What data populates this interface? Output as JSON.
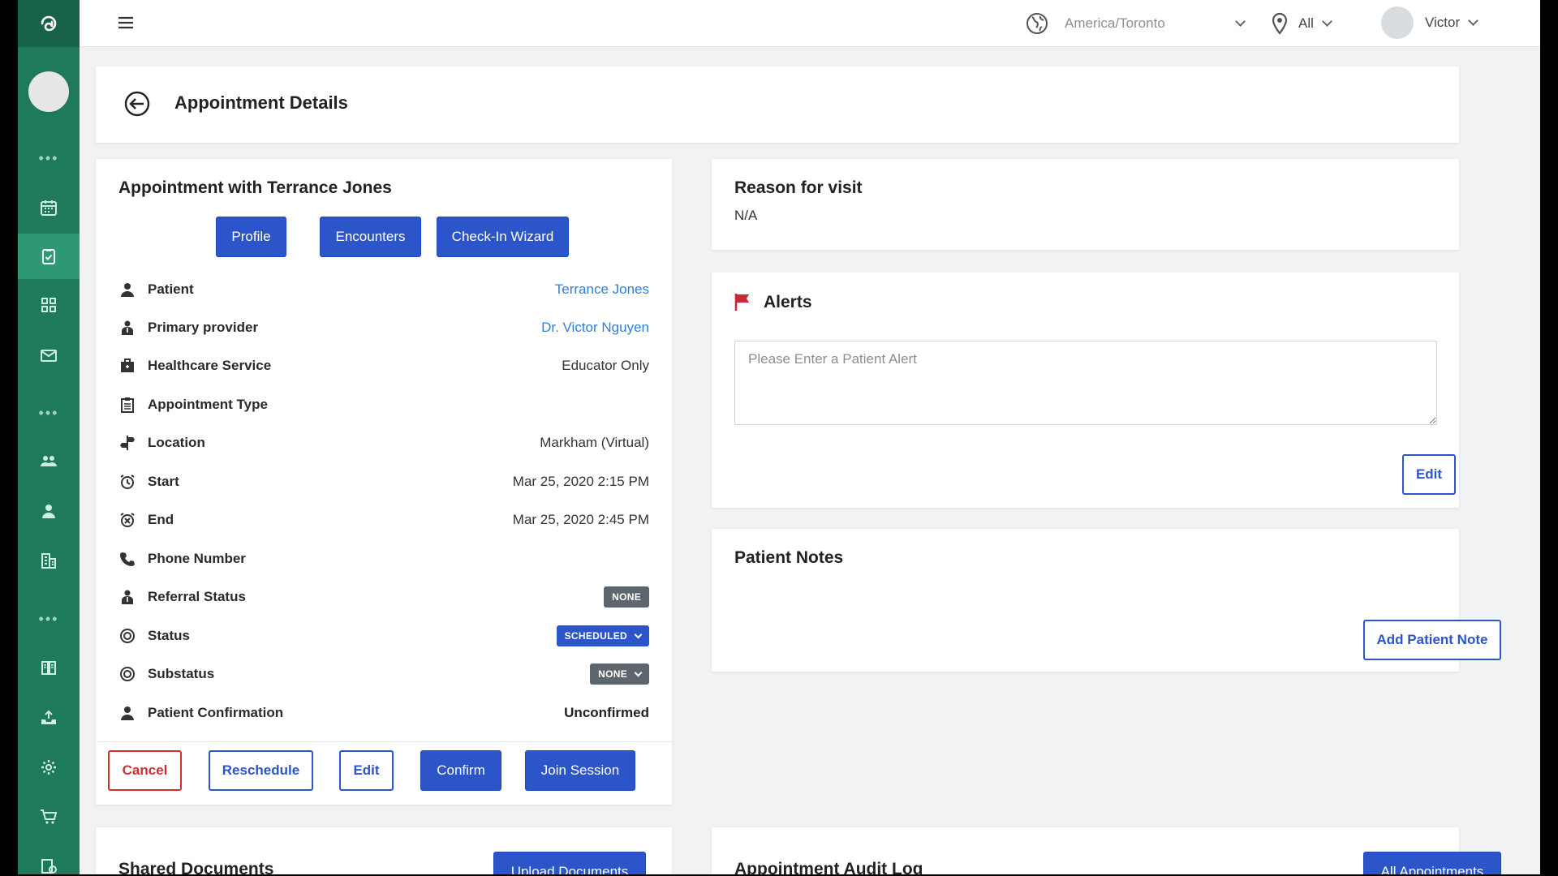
{
  "topbar": {
    "timezone": "America/Toronto",
    "location_filter": "All",
    "user_name": "Victor"
  },
  "header": {
    "title": "Appointment Details"
  },
  "appointment": {
    "title": "Appointment with Terrance Jones",
    "actions_top": {
      "profile": "Profile",
      "encounters": "Encounters",
      "checkin": "Check-In Wizard"
    },
    "rows": [
      {
        "label": "Patient",
        "value": "Terrance Jones",
        "icon": "user-icon"
      },
      {
        "label": "Primary provider",
        "value": "Dr. Victor Nguyen",
        "icon": "provider-icon"
      },
      {
        "label": "Healthcare Service",
        "value": "Educator Only",
        "icon": "briefcase-icon"
      },
      {
        "label": "Appointment Type",
        "value": "",
        "icon": "clipboard-icon"
      },
      {
        "label": "Location",
        "value": "Markham (Virtual)",
        "icon": "location-sign-icon"
      },
      {
        "label": "Start",
        "value": "Mar 25, 2020 2:15 PM",
        "icon": "alarm-icon"
      },
      {
        "label": "End",
        "value": "Mar 25, 2020 2:45 PM",
        "icon": "alarm-off-icon"
      },
      {
        "label": "Phone Number",
        "value": "",
        "icon": "phone-icon"
      },
      {
        "label": "Referral Status",
        "value": "NONE",
        "icon": "provider-icon"
      },
      {
        "label": "Status",
        "value": "SCHEDULED",
        "icon": "circle-icon"
      },
      {
        "label": "Substatus",
        "value": "NONE",
        "icon": "circle-icon"
      },
      {
        "label": "Patient Confirmation",
        "value": "Unconfirmed",
        "icon": "user-icon"
      }
    ],
    "actions_bottom": {
      "cancel": "Cancel",
      "reschedule": "Reschedule",
      "edit": "Edit",
      "confirm": "Confirm",
      "join": "Join Session"
    }
  },
  "reason": {
    "title": "Reason for visit",
    "value": "N/A"
  },
  "alerts": {
    "title": "Alerts",
    "placeholder": "Please Enter a Patient Alert",
    "edit_label": "Edit"
  },
  "notes": {
    "title": "Patient Notes",
    "add_label": "Add Patient Note"
  },
  "documents": {
    "title": "Shared Documents",
    "upload_label": "Upload Documents"
  },
  "audit": {
    "title": "Appointment Audit Log",
    "all_label": "All Appointments"
  },
  "colors": {
    "sidebar": "#1f7a5a",
    "primary": "#2b55c9",
    "danger": "#d12f2f",
    "link": "#2f7fd6"
  }
}
